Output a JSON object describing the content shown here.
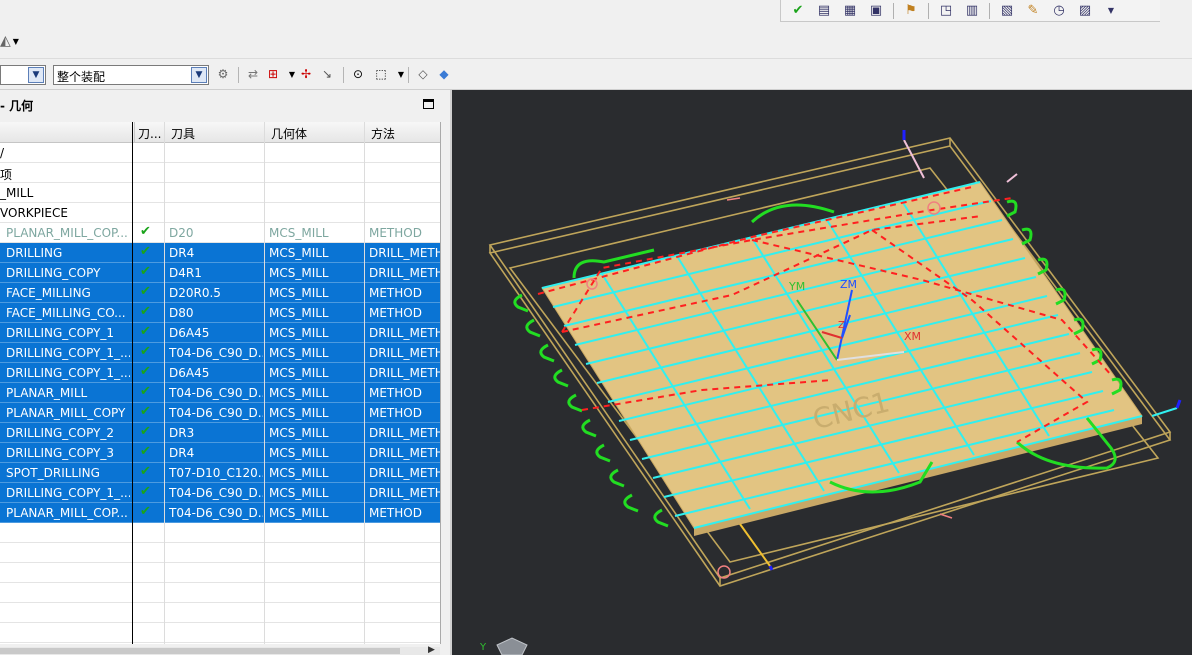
{
  "toolbar": {
    "filter_value": "",
    "assembly_value": "整个装配"
  },
  "panel": {
    "title": "- 几何"
  },
  "columns": [
    "刀...",
    "刀具",
    "几何体",
    "方法"
  ],
  "tree_rows": [
    {
      "name": "/",
      "check": false,
      "tool": "",
      "geometry": "",
      "method": ""
    },
    {
      "name": "项",
      "check": false,
      "tool": "",
      "geometry": "",
      "method": ""
    },
    {
      "name": "_MILL",
      "check": false,
      "tool": "",
      "geometry": "",
      "method": ""
    },
    {
      "name": "VORKPIECE",
      "check": false,
      "tool": "",
      "geometry": "",
      "method": ""
    }
  ],
  "operations": [
    {
      "name": "PLANAR_MILL_COP...",
      "tool": "D20",
      "geometry": "MCS_MILL",
      "method": "METHOD",
      "selected": false
    },
    {
      "name": "DRILLING",
      "tool": "DR4",
      "geometry": "MCS_MILL",
      "method": "DRILL_METH",
      "selected": true
    },
    {
      "name": "DRILLING_COPY",
      "tool": "D4R1",
      "geometry": "MCS_MILL",
      "method": "DRILL_METH",
      "selected": true
    },
    {
      "name": "FACE_MILLING",
      "tool": "D20R0.5",
      "geometry": "MCS_MILL",
      "method": "METHOD",
      "selected": true
    },
    {
      "name": "FACE_MILLING_CO...",
      "tool": "D80",
      "geometry": "MCS_MILL",
      "method": "METHOD",
      "selected": true
    },
    {
      "name": "DRILLING_COPY_1",
      "tool": "D6A45",
      "geometry": "MCS_MILL",
      "method": "DRILL_METH",
      "selected": true
    },
    {
      "name": "DRILLING_COPY_1_...",
      "tool": "T04-D6_C90_D...",
      "geometry": "MCS_MILL",
      "method": "DRILL_METH",
      "selected": true
    },
    {
      "name": "DRILLING_COPY_1_...",
      "tool": "D6A45",
      "geometry": "MCS_MILL",
      "method": "DRILL_METH",
      "selected": true
    },
    {
      "name": "PLANAR_MILL",
      "tool": "T04-D6_C90_D...",
      "geometry": "MCS_MILL",
      "method": "METHOD",
      "selected": true
    },
    {
      "name": "PLANAR_MILL_COPY",
      "tool": "T04-D6_C90_D...",
      "geometry": "MCS_MILL",
      "method": "METHOD",
      "selected": true
    },
    {
      "name": "DRILLING_COPY_2",
      "tool": "DR3",
      "geometry": "MCS_MILL",
      "method": "DRILL_METH",
      "selected": true
    },
    {
      "name": "DRILLING_COPY_3",
      "tool": "DR4",
      "geometry": "MCS_MILL",
      "method": "DRILL_METH",
      "selected": true
    },
    {
      "name": "SPOT_DRILLING",
      "tool": "T07-D10_C120...",
      "geometry": "MCS_MILL",
      "method": "DRILL_METH",
      "selected": true
    },
    {
      "name": "DRILLING_COPY_1_...",
      "tool": "T04-D6_C90_D...",
      "geometry": "MCS_MILL",
      "method": "DRILL_METH",
      "selected": true
    },
    {
      "name": "PLANAR_MILL_COP...",
      "tool": "T04-D6_C90_D...",
      "geometry": "MCS_MILL",
      "method": "METHOD",
      "selected": true
    }
  ],
  "viewport": {
    "axis_labels": {
      "zm": "ZM",
      "ym": "YM",
      "xm": "XM",
      "z": "Z",
      "y": "Y"
    },
    "part_text": "CNC1"
  },
  "colors": {
    "selection": "#0a74d4",
    "viewport_bg": "#2a2c2f",
    "stock": "#e6c98a",
    "toolpath_cyan": "#30f0f0",
    "toolpath_green": "#22dd22",
    "rapid_red": "#ff2020",
    "check_green": "#1aa31a"
  }
}
